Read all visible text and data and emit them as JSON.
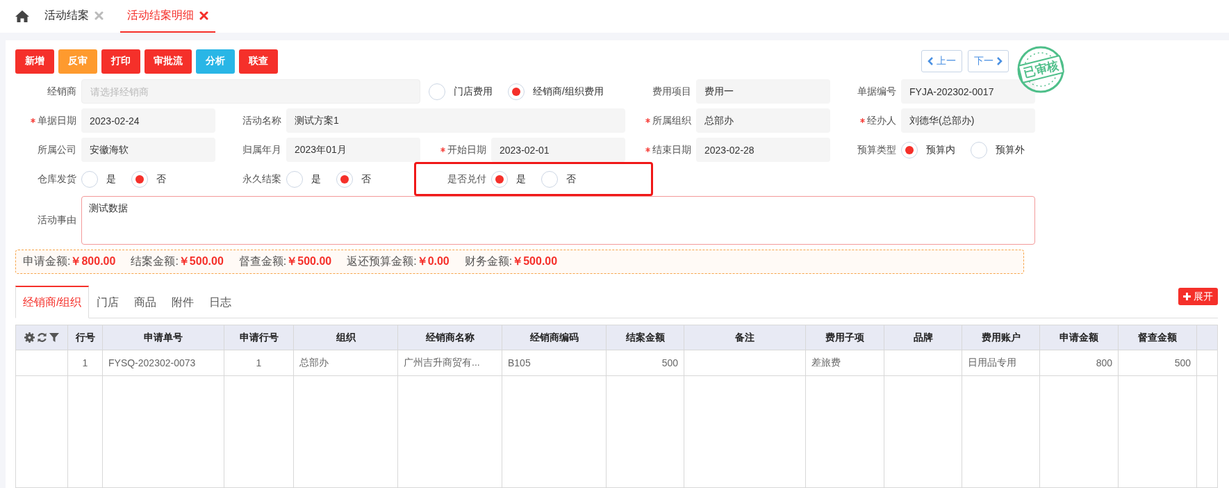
{
  "nav_tabs": [
    {
      "label": "活动结案",
      "selected": false
    },
    {
      "label": "活动结案明细",
      "selected": true
    }
  ],
  "toolbar": [
    {
      "label": "新增",
      "kind": "danger"
    },
    {
      "label": "反审",
      "kind": "warning"
    },
    {
      "label": "打印",
      "kind": "danger"
    },
    {
      "label": "审批流",
      "kind": "danger"
    },
    {
      "label": "分析",
      "kind": "info"
    },
    {
      "label": "联查",
      "kind": "danger"
    }
  ],
  "pager": [
    {
      "label": "上一",
      "kind": "prev"
    },
    {
      "label": "下一",
      "kind": "next"
    }
  ],
  "stamp": {
    "text": "已审核"
  },
  "form": {
    "rows": [
      {
        "items": [
          {
            "kind": "wide_field",
            "label": "经销商",
            "required": false,
            "placeholder": "请选择经销商"
          },
          {
            "kind": "options",
            "options": [
              {
                "label": "门店费用",
                "selected": false
              },
              {
                "label": "经销商/组织费用",
                "selected": true
              }
            ]
          },
          {
            "kind": "field",
            "label": "费用项目",
            "required": false,
            "value": "费用一"
          },
          {
            "kind": "field",
            "label": "单据编号",
            "required": false,
            "value": "FYJA-202302-0017"
          }
        ]
      },
      {
        "items": [
          {
            "kind": "field",
            "label": "单据日期",
            "required": true,
            "value": "2023-02-24"
          },
          {
            "kind": "wide_field",
            "label": "活动名称",
            "required": false,
            "value": "测试方案1"
          },
          {
            "kind": "field",
            "label": "所属组织",
            "required": true,
            "value": "总部办"
          },
          {
            "kind": "field",
            "label": "经办人",
            "required": true,
            "value": "刘德华(总部办)"
          }
        ]
      },
      {
        "items": [
          {
            "kind": "field",
            "label": "所属公司",
            "required": false,
            "value": "安徽海软"
          },
          {
            "kind": "field",
            "label": "归属年月",
            "required": false,
            "value": "2023年01月"
          },
          {
            "kind": "field",
            "label": "开始日期",
            "required": true,
            "value": "2023-02-01"
          },
          {
            "kind": "field",
            "label": "结束日期",
            "required": true,
            "value": "2023-02-28"
          },
          {
            "kind": "radio_group",
            "label": "预算类型",
            "highlighted": false,
            "options": [
              {
                "label": "预算内",
                "selected": true
              },
              {
                "label": "预算外",
                "selected": false
              }
            ]
          }
        ]
      },
      {
        "items": [
          {
            "kind": "radio_group",
            "label": "仓库发货",
            "highlighted": false,
            "options": [
              {
                "label": "是",
                "selected": false
              },
              {
                "label": "否",
                "selected": true
              }
            ]
          },
          {
            "kind": "radio_group",
            "label": "永久结案",
            "highlighted": false,
            "options": [
              {
                "label": "是",
                "selected": false
              },
              {
                "label": "否",
                "selected": true
              }
            ]
          },
          {
            "kind": "radio_group",
            "label": "是否兑付",
            "highlighted": true,
            "options": [
              {
                "label": "是",
                "selected": true
              },
              {
                "label": "否",
                "selected": false
              }
            ]
          }
        ]
      },
      {
        "items": [
          {
            "kind": "textarea",
            "label": "活动事由",
            "required": false,
            "value": "测试数据"
          }
        ]
      }
    ]
  },
  "summary": [
    {
      "label": "申请金额:",
      "value": "￥800.00"
    },
    {
      "label": "结案金额:",
      "value": "￥500.00"
    },
    {
      "label": "督查金额:",
      "value": "￥500.00"
    },
    {
      "label": "返还预算金额:",
      "value": "￥0.00"
    },
    {
      "label": "财务金额:",
      "value": "￥500.00"
    }
  ],
  "detail_tabs": [
    {
      "label": "经销商/组织",
      "selected": true
    },
    {
      "label": "门店",
      "selected": false
    },
    {
      "label": "商品",
      "selected": false
    },
    {
      "label": "附件",
      "selected": false
    },
    {
      "label": "日志",
      "selected": false
    }
  ],
  "expand_button": {
    "label": "展开"
  },
  "table": {
    "columns": [
      {
        "label": "行号",
        "kind": "index"
      },
      {
        "label": "申请单号",
        "kind": "text"
      },
      {
        "label": "申请行号",
        "kind": "index"
      },
      {
        "label": "组织",
        "kind": "text"
      },
      {
        "label": "经销商名称",
        "kind": "text"
      },
      {
        "label": "经销商编码",
        "kind": "text"
      },
      {
        "label": "结案金额",
        "kind": "number"
      },
      {
        "label": "备注",
        "kind": "text"
      },
      {
        "label": "费用子项",
        "kind": "text"
      },
      {
        "label": "品牌",
        "kind": "text"
      },
      {
        "label": "费用账户",
        "kind": "text"
      },
      {
        "label": "申请金额",
        "kind": "number"
      },
      {
        "label": "督查金额",
        "kind": "number"
      }
    ],
    "rows": [
      [
        "1",
        "FYSQ-202302-0073",
        "1",
        "总部办",
        "广州吉升商贸有...",
        "B105",
        "500",
        null,
        "差旅费",
        null,
        "日用品专用",
        "800",
        "500"
      ]
    ]
  }
}
